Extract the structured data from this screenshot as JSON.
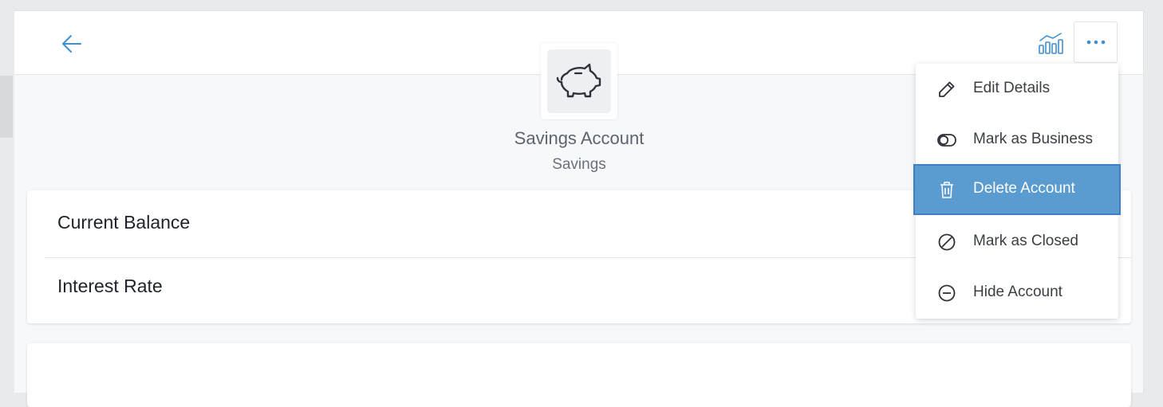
{
  "colors": {
    "accent": "#3f8fd0",
    "highlight": "#5a9bd0",
    "text_primary": "#1f2328",
    "text_muted": "#5c6470"
  },
  "header": {
    "back_icon": "arrow-left-icon",
    "chart_icon": "bar-chart-icon",
    "more_icon": "ellipsis-icon"
  },
  "account": {
    "icon": "piggy-bank-icon",
    "name": "Savings Account",
    "type": "Savings"
  },
  "details": [
    {
      "label": "Current Balance"
    },
    {
      "label": "Interest Rate"
    }
  ],
  "menu": {
    "items": [
      {
        "label": "Edit Details",
        "icon": "pencil-icon"
      },
      {
        "label": "Mark as Business",
        "icon": "toggle-icon"
      },
      {
        "label": "Delete Account",
        "icon": "trash-icon",
        "highlighted": true
      },
      {
        "label": "Mark as Closed",
        "icon": "slash-circle-icon"
      },
      {
        "label": "Hide Account",
        "icon": "minus-circle-icon"
      }
    ]
  }
}
